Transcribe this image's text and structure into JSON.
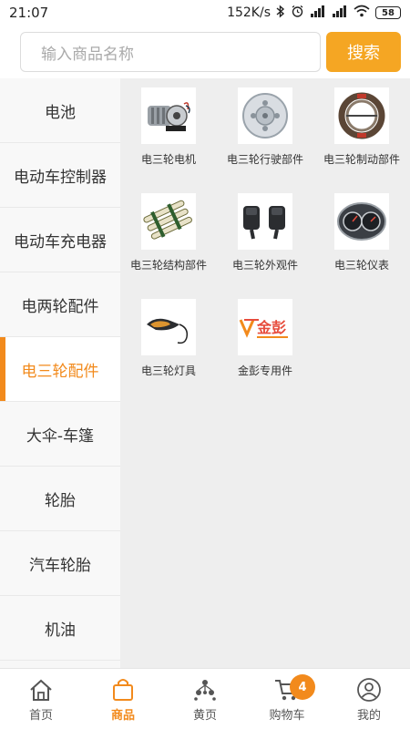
{
  "status_bar": {
    "time": "21:07",
    "network_speed": "152K/s",
    "battery": "58"
  },
  "search": {
    "placeholder": "输入商品名称",
    "button_label": "搜索"
  },
  "colors": {
    "accent": "#f28a1c",
    "search_button": "#f5a623"
  },
  "sidebar": {
    "active_index": 4,
    "items": [
      {
        "label": "电池"
      },
      {
        "label": "电动车控制器"
      },
      {
        "label": "电动车充电器"
      },
      {
        "label": "电两轮配件"
      },
      {
        "label": "电三轮配件"
      },
      {
        "label": "大伞-车篷"
      },
      {
        "label": "轮胎"
      },
      {
        "label": "汽车轮胎"
      },
      {
        "label": "机油"
      }
    ]
  },
  "products": [
    {
      "label": "电三轮电机",
      "icon": "motor-icon"
    },
    {
      "label": "电三轮行驶部件",
      "icon": "wheel-hub-icon"
    },
    {
      "label": "电三轮制动部件",
      "icon": "brake-shoe-icon"
    },
    {
      "label": "电三轮结构部件",
      "icon": "leaf-spring-icon"
    },
    {
      "label": "电三轮外观件",
      "icon": "mirror-icon"
    },
    {
      "label": "电三轮仪表",
      "icon": "gauge-icon"
    },
    {
      "label": "电三轮灯具",
      "icon": "turn-signal-icon"
    },
    {
      "label": "金彭专用件",
      "icon": "jinpeng-logo",
      "logo_text": "金彭"
    }
  ],
  "bottom_nav": {
    "active_index": 1,
    "items": [
      {
        "label": "首页",
        "icon": "home-icon"
      },
      {
        "label": "商品",
        "icon": "shopping-bag-icon"
      },
      {
        "label": "黄页",
        "icon": "network-icon"
      },
      {
        "label": "购物车",
        "icon": "cart-icon",
        "badge": "4"
      },
      {
        "label": "我的",
        "icon": "profile-icon"
      }
    ]
  }
}
